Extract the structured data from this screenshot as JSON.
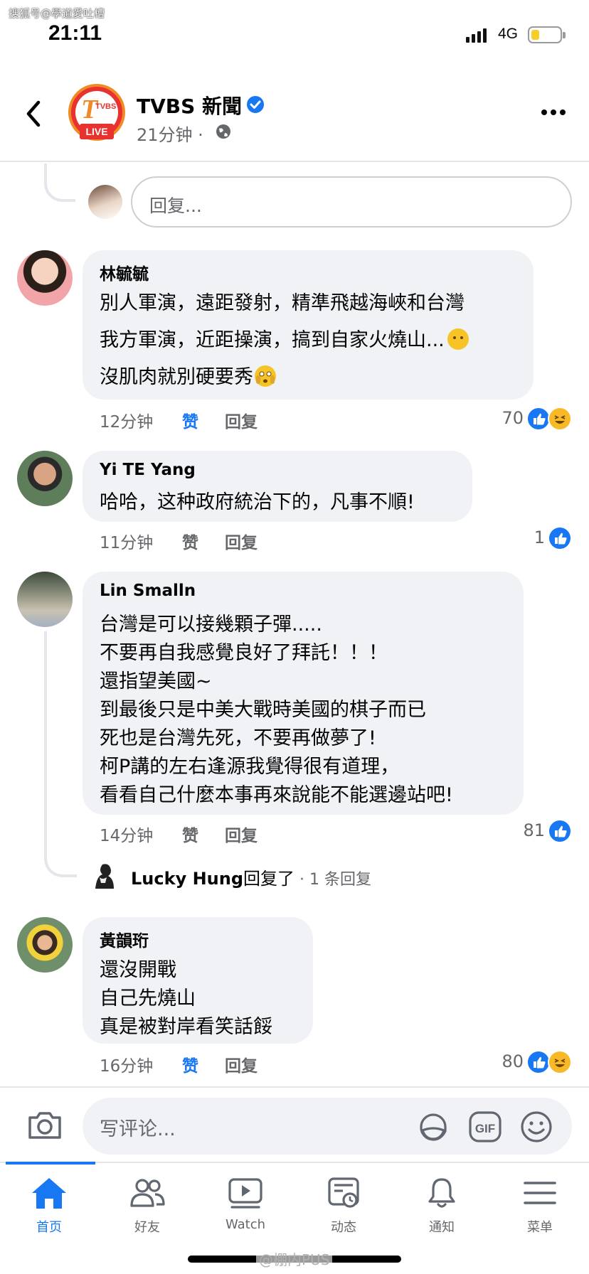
{
  "watermark_top": "搜狐号@學道愛吐槽",
  "status_bar": {
    "time": "21:11",
    "network": "4G",
    "battery_level": 0.3
  },
  "header": {
    "page_name": "TVBS 新聞",
    "avatar_text": "T",
    "avatar_sub": "TVBS",
    "live_label": "LIVE",
    "post_time": "21分钟 ·"
  },
  "reply_input": {
    "placeholder": "回复..."
  },
  "comments": [
    {
      "name": "林毓毓",
      "lines": [
        "別人軍演，遠距發射，精準飛越海峽和台灣",
        "我方軍演，近距操演，搞到自家火燒山...",
        "沒肌肉就別硬要秀"
      ],
      "time": "12分钟",
      "like": "赞",
      "reply": "回复",
      "liked": true,
      "reaction_count": "70",
      "reactions": [
        "like",
        "haha"
      ]
    },
    {
      "name": "Yi TE Yang",
      "lines": [
        "哈哈，这种政府統治下的，凡事不順!"
      ],
      "time": "11分钟",
      "like": "赞",
      "reply": "回复",
      "liked": false,
      "reaction_count": "1",
      "reactions": [
        "like"
      ]
    },
    {
      "name": "Lin Smalln",
      "lines": [
        "台灣是可以接幾顆子彈.....",
        "不要再自我感覺良好了拜託！！！",
        "還指望美國~",
        "到最後只是中美大戰時美國的棋子而已",
        "死也是台灣先死，不要再做夢了!",
        "柯P講的左右逢源我覺得很有道理，",
        "看看自己什麼本事再來說能不能選邊站吧!"
      ],
      "time": "14分钟",
      "like": "赞",
      "reply": "回复",
      "liked": false,
      "reaction_count": "81",
      "reactions": [
        "like"
      ]
    },
    {
      "name": "黃韻珩",
      "lines": [
        "還沒開戰",
        "自己先燒山",
        "真是被對岸看笑話餒"
      ],
      "time": "16分钟",
      "like": "赞",
      "reply": "回复",
      "liked": true,
      "reaction_count": "80",
      "reactions": [
        "like",
        "haha"
      ]
    }
  ],
  "lucky_reply": {
    "name": "Lucky Hung",
    "text": "回复了",
    "count": " · 1 条回复"
  },
  "composer": {
    "placeholder": "写评论...",
    "gif_label": "GIF"
  },
  "tabs": [
    {
      "label": "首页",
      "icon": "home-icon",
      "active": true
    },
    {
      "label": "好友",
      "icon": "friends-icon",
      "active": false
    },
    {
      "label": "Watch",
      "icon": "watch-icon",
      "active": false
    },
    {
      "label": "动态",
      "icon": "feed-icon",
      "active": false
    },
    {
      "label": "通知",
      "icon": "bell-icon",
      "active": false
    },
    {
      "label": "菜单",
      "icon": "menu-icon",
      "active": false
    }
  ],
  "watermark_bottom": "@棚内PUS",
  "colors": {
    "accent": "#1877f2",
    "bubble": "#f0f2f5",
    "meta": "#65676b",
    "live": "#e8322f"
  }
}
